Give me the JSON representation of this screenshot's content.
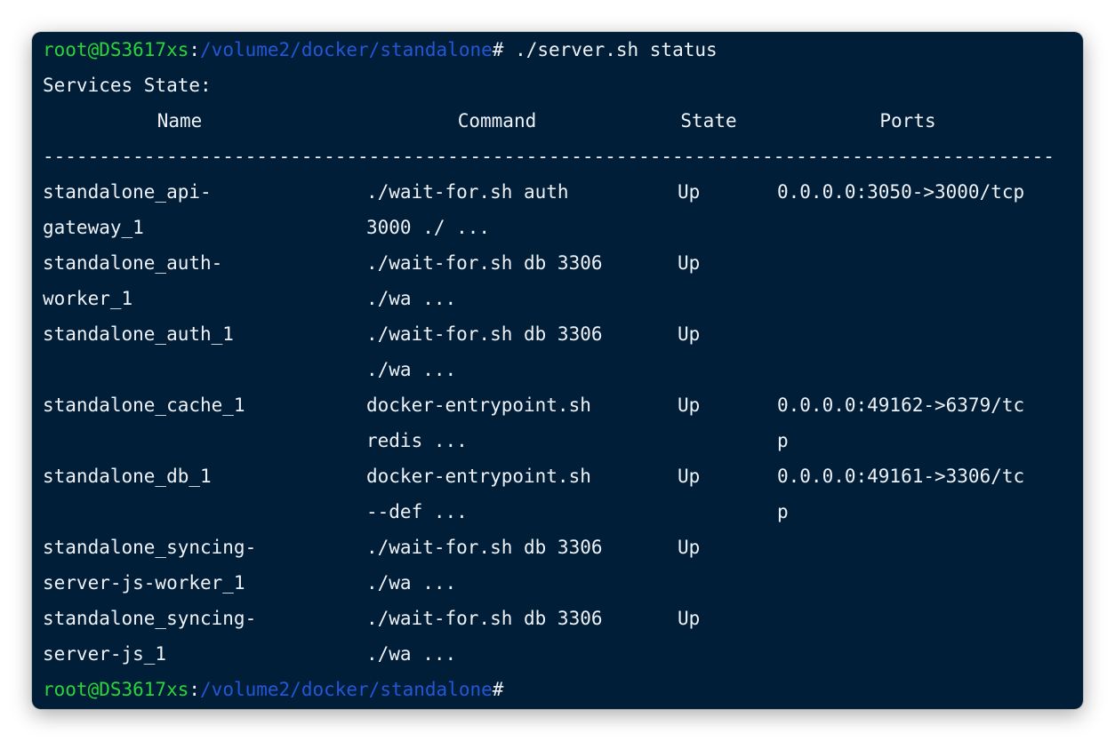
{
  "prompt": {
    "user_host": "root@DS3617xs",
    "colon": ":",
    "path": "/volume2/docker/standalone",
    "hash": "#",
    "command": " ./server.sh status"
  },
  "output": {
    "heading": "Services State:",
    "columns": {
      "name": "Name",
      "command": "Command",
      "state": "State",
      "ports": "Ports"
    },
    "separator": "------------------------------------------------------------------------------------------------------------------------------",
    "rows": [
      {
        "name": [
          "standalone_api-",
          "gateway_1"
        ],
        "command": [
          "./wait-for.sh auth",
          "3000 ./ ..."
        ],
        "state": "Up",
        "ports": [
          "0.0.0.0:3050->3000/tcp",
          ""
        ]
      },
      {
        "name": [
          "standalone_auth-",
          "worker_1"
        ],
        "command": [
          "./wait-for.sh db 3306",
          "./wa ..."
        ],
        "state": "Up",
        "ports": [
          "",
          ""
        ]
      },
      {
        "name": [
          "standalone_auth_1",
          ""
        ],
        "command": [
          "./wait-for.sh db 3306",
          "./wa ..."
        ],
        "state": "Up",
        "ports": [
          "",
          ""
        ]
      },
      {
        "name": [
          "standalone_cache_1",
          ""
        ],
        "command": [
          "docker-entrypoint.sh",
          "redis ..."
        ],
        "state": "Up",
        "ports": [
          "0.0.0.0:49162->6379/tc",
          "p"
        ]
      },
      {
        "name": [
          "standalone_db_1",
          ""
        ],
        "command": [
          "docker-entrypoint.sh",
          "--def ..."
        ],
        "state": "Up",
        "ports": [
          "0.0.0.0:49161->3306/tc",
          "p"
        ]
      },
      {
        "name": [
          "standalone_syncing-",
          "server-js-worker_1"
        ],
        "command": [
          "./wait-for.sh db 3306",
          "./wa ..."
        ],
        "state": "Up",
        "ports": [
          "",
          ""
        ]
      },
      {
        "name": [
          "standalone_syncing-",
          "server-js_1"
        ],
        "command": [
          "./wait-for.sh db 3306",
          "./wa ..."
        ],
        "state": "Up",
        "ports": [
          "",
          ""
        ]
      }
    ]
  },
  "final_prompt": {
    "user_host": "root@DS3617xs",
    "colon": ":",
    "path": "/volume2/docker/standalone",
    "hash": "#"
  },
  "colors": {
    "background": "#001e38",
    "user_host": "#2bd43a",
    "path": "#2357d6",
    "text": "#eef2f6"
  }
}
